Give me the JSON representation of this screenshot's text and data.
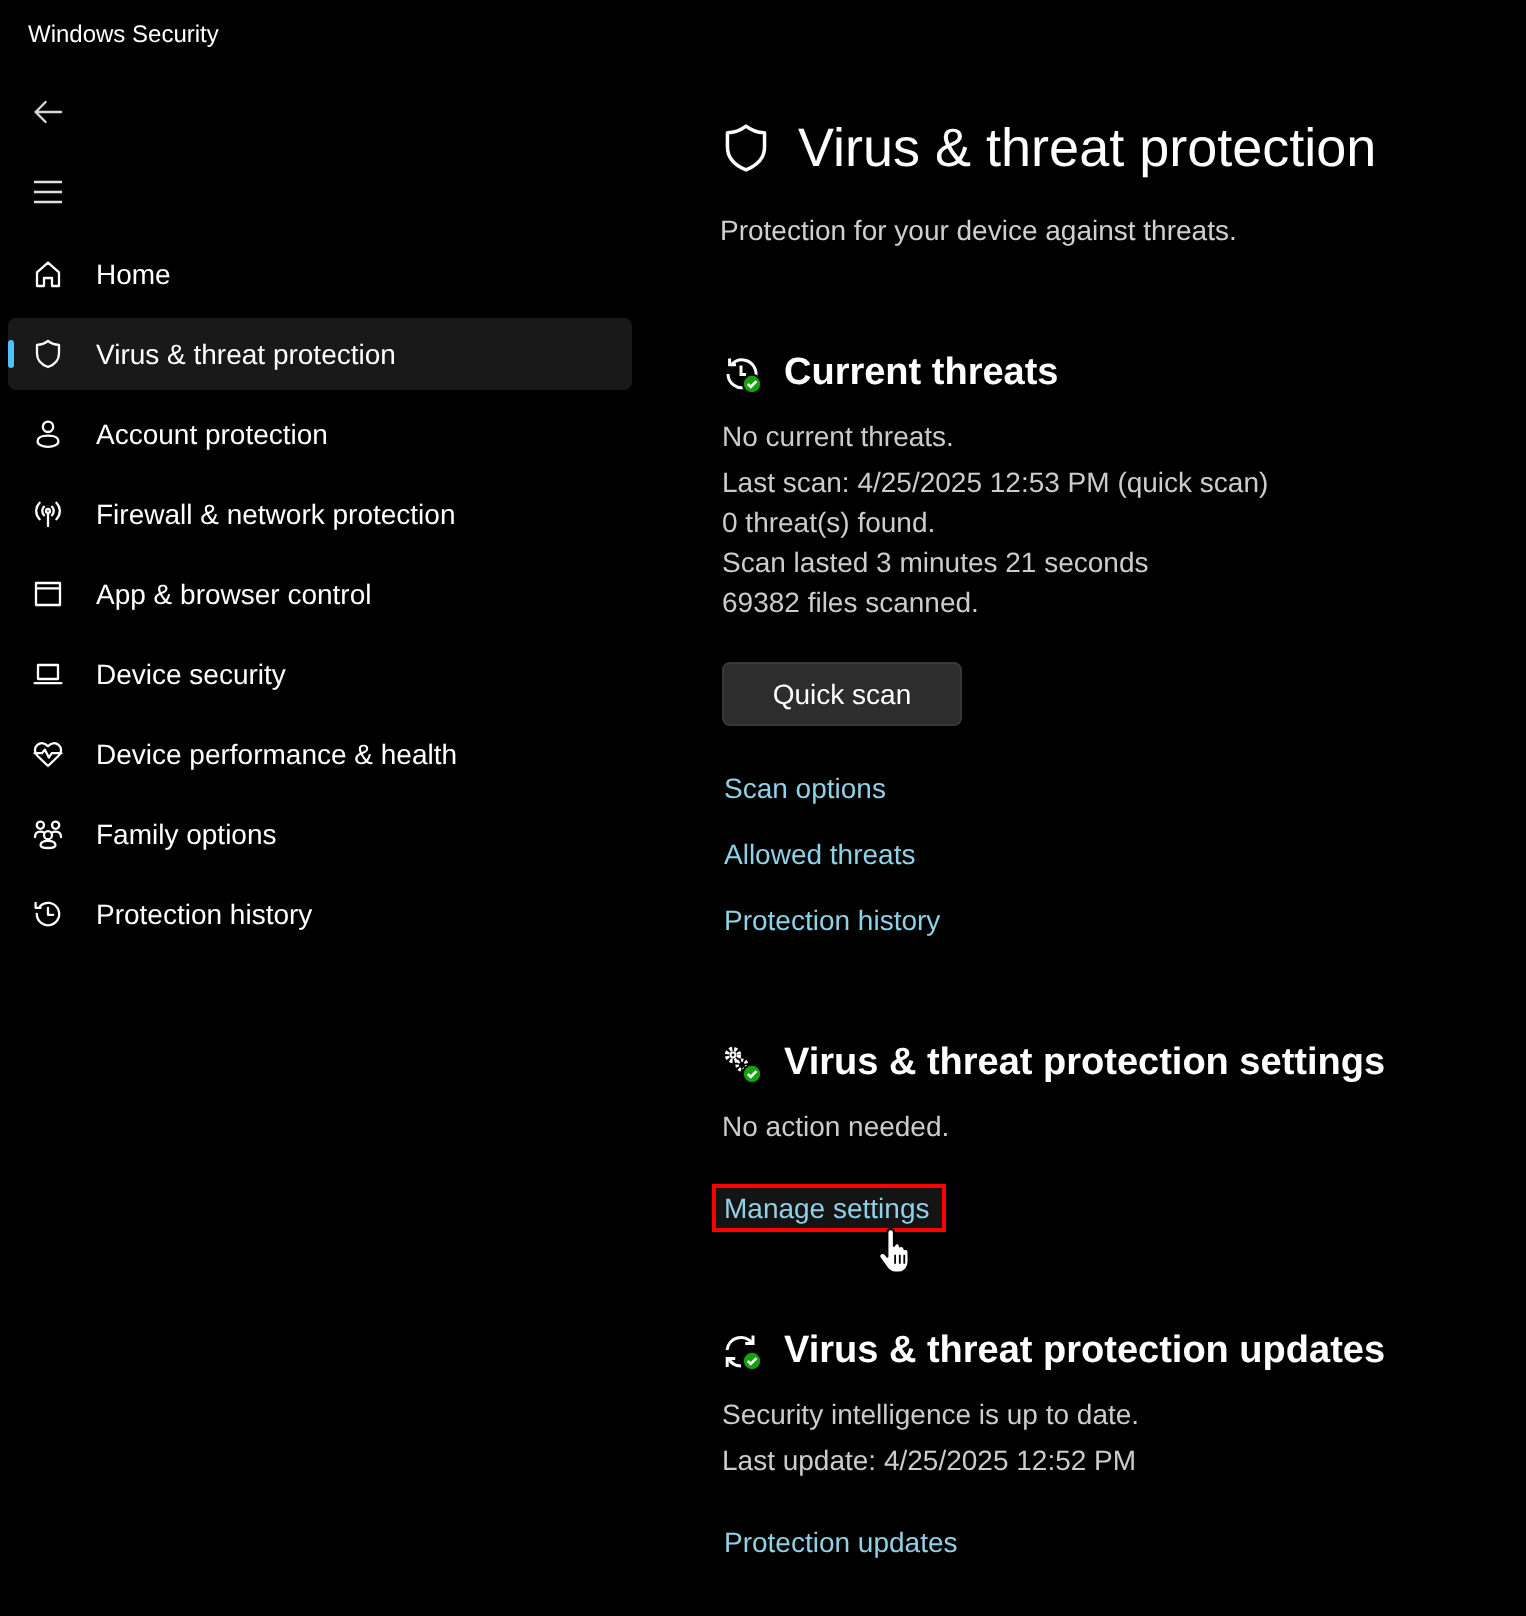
{
  "window": {
    "title": "Windows Security"
  },
  "sidebar": {
    "items": [
      {
        "label": "Home",
        "selected": false
      },
      {
        "label": "Virus & threat protection",
        "selected": true
      },
      {
        "label": "Account protection",
        "selected": false
      },
      {
        "label": "Firewall & network protection",
        "selected": false
      },
      {
        "label": "App & browser control",
        "selected": false
      },
      {
        "label": "Device security",
        "selected": false
      },
      {
        "label": "Device performance & health",
        "selected": false
      },
      {
        "label": "Family options",
        "selected": false
      },
      {
        "label": "Protection history",
        "selected": false
      }
    ]
  },
  "page": {
    "title": "Virus & threat protection",
    "subtitle": "Protection for your device against threats."
  },
  "sections": [
    {
      "heading": "Current threats",
      "status": "No current threats.",
      "details": [
        "Last scan: 4/25/2025 12:53 PM (quick scan)",
        "0 threat(s) found.",
        "Scan lasted 3 minutes 21 seconds",
        "69382 files scanned."
      ],
      "button": "Quick scan",
      "links": [
        {
          "label": "Scan options",
          "highlighted": false
        },
        {
          "label": "Allowed threats",
          "highlighted": false
        },
        {
          "label": "Protection history",
          "highlighted": false
        }
      ]
    },
    {
      "heading": "Virus & threat protection settings",
      "status": "No action needed.",
      "links": [
        {
          "label": "Manage settings",
          "highlighted": true
        }
      ]
    },
    {
      "heading": "Virus & threat protection updates",
      "status": "Security intelligence is up to date.",
      "details": [
        "Last update: 4/25/2025 12:52 PM"
      ],
      "links": [
        {
          "label": "Protection updates",
          "highlighted": false
        }
      ]
    }
  ]
}
